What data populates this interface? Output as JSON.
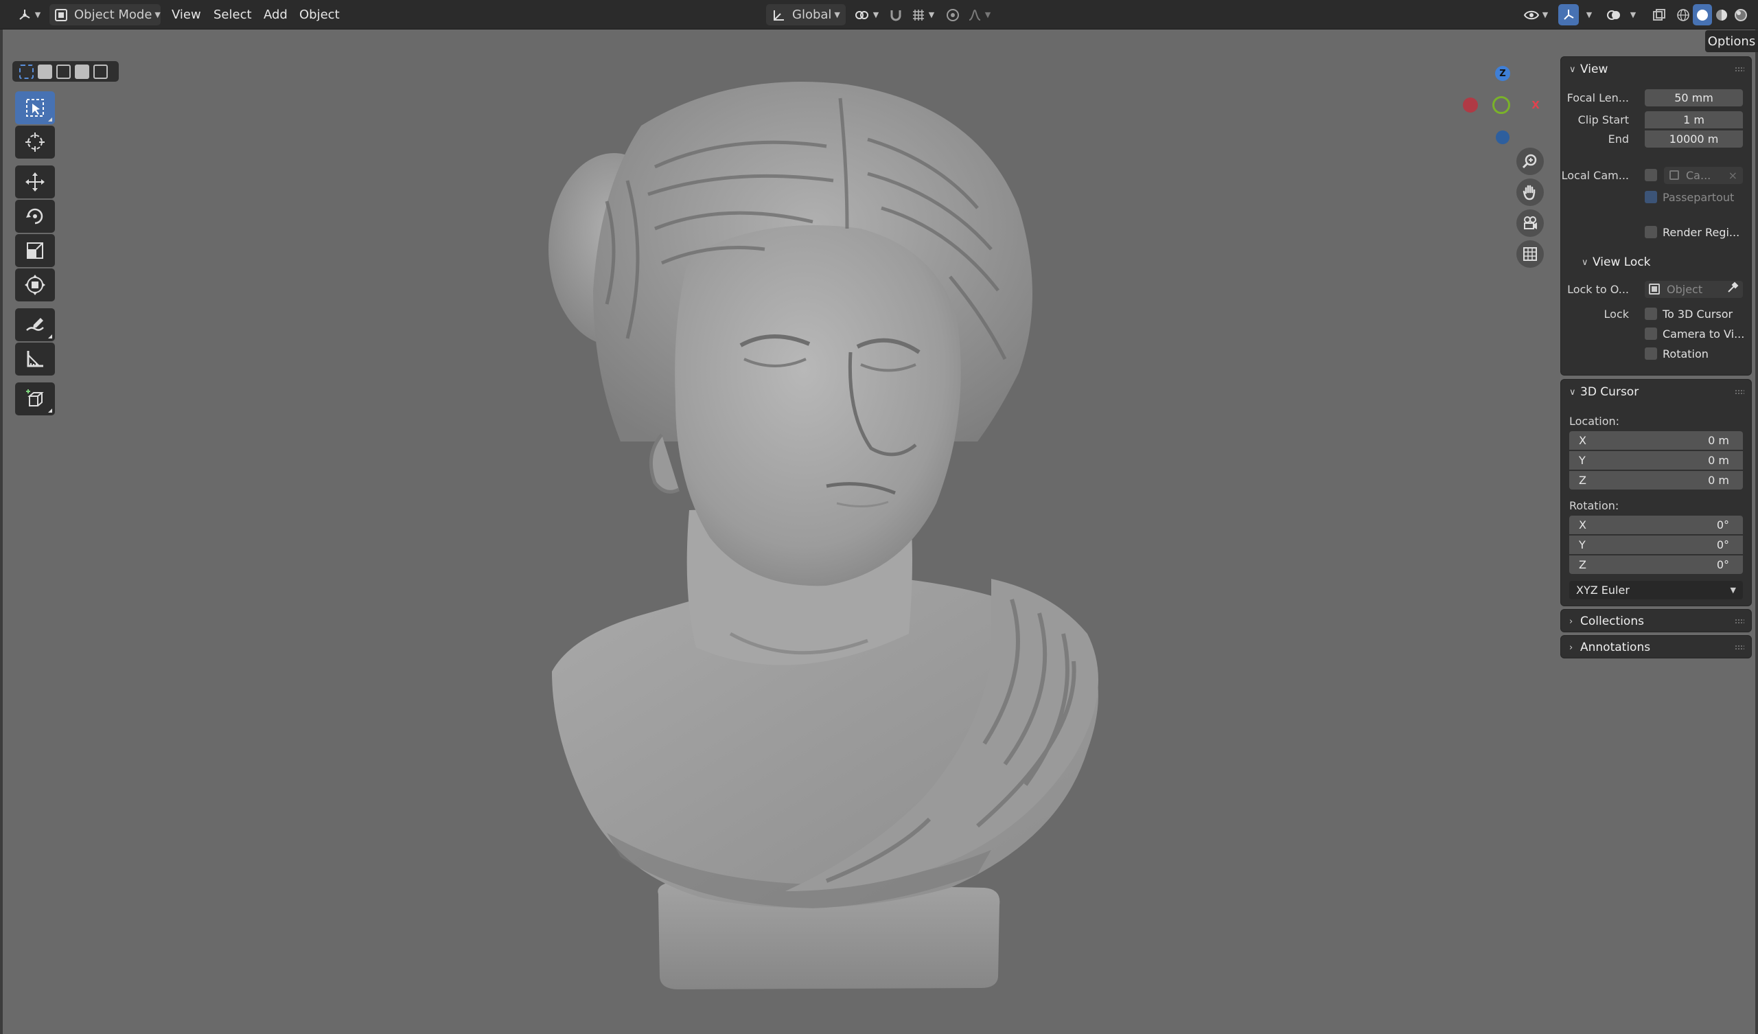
{
  "header": {
    "mode_label": "Object Mode",
    "menus": [
      "View",
      "Select",
      "Add",
      "Object"
    ],
    "orientation_label": "Global"
  },
  "options_label": "Options",
  "tools": [
    "select-box",
    "cursor",
    "move",
    "rotate",
    "scale",
    "transform",
    "annotate",
    "measure",
    "add-cube"
  ],
  "gizmo": {
    "z_label": "Z",
    "x_label": "X",
    "x_color": "#e0424e",
    "y_color": "#7ab22a",
    "z_color": "#3f7fd6"
  },
  "colors": {
    "accent": "#4772b3",
    "viewport_bg": "#6a6a6a",
    "panel_bg": "#303030"
  },
  "view_panel": {
    "title": "View",
    "focal_length_label": "Focal Len...",
    "focal_length_value": "50 mm",
    "clip_start_label": "Clip Start",
    "clip_start_value": "1 m",
    "clip_end_label": "End",
    "clip_end_value": "10000 m",
    "local_camera_label": "Local Cam...",
    "local_camera_value": "Ca...",
    "passepartout_label": "Passepartout",
    "render_region_label": "Render Regi...",
    "view_lock_title": "View Lock",
    "lock_to_object_label": "Lock to O...",
    "lock_to_object_placeholder": "Object",
    "lock_label": "Lock",
    "lock_options": [
      "To 3D Cursor",
      "Camera to Vi...",
      "Rotation"
    ]
  },
  "cursor_panel": {
    "title": "3D Cursor",
    "location_label": "Location:",
    "location": [
      {
        "axis": "X",
        "value": "0 m"
      },
      {
        "axis": "Y",
        "value": "0 m"
      },
      {
        "axis": "Z",
        "value": "0 m"
      }
    ],
    "rotation_label": "Rotation:",
    "rotation": [
      {
        "axis": "X",
        "value": "0°"
      },
      {
        "axis": "Y",
        "value": "0°"
      },
      {
        "axis": "Z",
        "value": "0°"
      }
    ],
    "rotation_mode": "XYZ Euler"
  },
  "collections_label": "Collections",
  "annotations_label": "Annotations"
}
